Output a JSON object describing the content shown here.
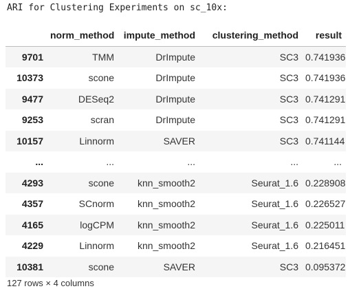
{
  "output": {
    "title": "ARI for Clustering Experiments on sc_10x:"
  },
  "table": {
    "columns": [
      "",
      "norm_method",
      "impute_method",
      "clustering_method",
      "result"
    ],
    "rows": [
      [
        "9701",
        "TMM",
        "DrImpute",
        "SC3",
        "0.741936"
      ],
      [
        "10373",
        "scone",
        "DrImpute",
        "SC3",
        "0.741936"
      ],
      [
        "9477",
        "DESeq2",
        "DrImpute",
        "SC3",
        "0.741291"
      ],
      [
        "9253",
        "scran",
        "DrImpute",
        "SC3",
        "0.741291"
      ],
      [
        "10157",
        "Linnorm",
        "SAVER",
        "SC3",
        "0.741144"
      ],
      [
        "...",
        "...",
        "...",
        "...",
        "..."
      ],
      [
        "4293",
        "scone",
        "knn_smooth2",
        "Seurat_1.6",
        "0.228908"
      ],
      [
        "4357",
        "SCnorm",
        "knn_smooth2",
        "Seurat_1.6",
        "0.226527"
      ],
      [
        "4165",
        "logCPM",
        "knn_smooth2",
        "Seurat_1.6",
        "0.225011"
      ],
      [
        "4229",
        "Linnorm",
        "knn_smooth2",
        "Seurat_1.6",
        "0.216451"
      ],
      [
        "10381",
        "scone",
        "SAVER",
        "SC3",
        "0.095372"
      ]
    ]
  },
  "footer": {
    "summary": "127 rows × 4 columns"
  }
}
